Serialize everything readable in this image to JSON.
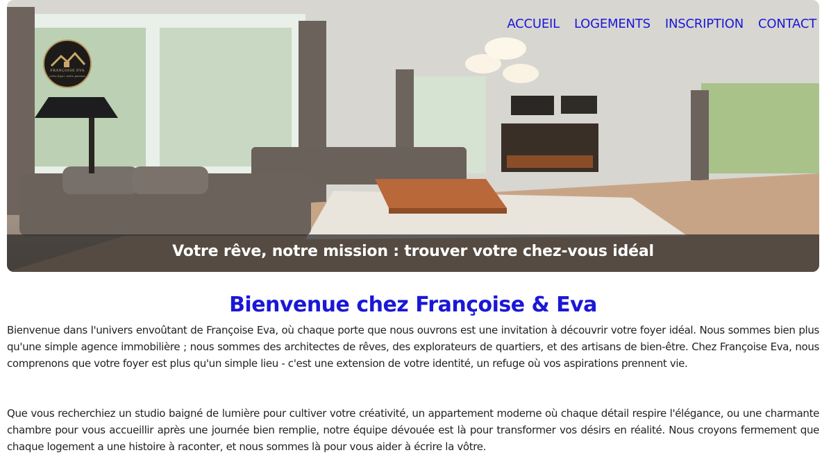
{
  "nav": {
    "items": [
      "ACCUEIL",
      "LOGEMENTS",
      "INSCRIPTION",
      "CONTACT"
    ]
  },
  "logo": {
    "name": "FRANÇOISE EVA",
    "tagline": "votre foyer, notre passion"
  },
  "hero": {
    "caption": "Votre rêve, notre mission : trouver votre chez-vous idéal"
  },
  "main": {
    "title": "Bienvenue chez Françoise & Eva",
    "paragraphs": [
      "Bienvenue dans l'univers envoûtant de Françoise Eva, où chaque porte que nous ouvrons est une invitation à découvrir votre foyer idéal. Nous sommes bien plus qu'une simple agence immobilière ; nous sommes des architectes de rêves, des explorateurs de quartiers, et des artisans de bien-être. Chez Françoise Eva, nous comprenons que votre foyer est plus qu'un simple lieu - c'est une extension de votre identité, un refuge où vos aspirations prennent vie.",
      "Que vous recherchiez un studio baigné de lumière pour cultiver votre créativité, un appartement moderne où chaque détail respire l'élégance, ou une charmante chambre pour vous accueillir après une journée bien remplie, notre équipe dévouée est là pour transformer vos désirs en réalité. Nous croyons fermement que chaque logement a une histoire à raconter, et nous sommes là pour vous aider à écrire la vôtre."
    ]
  },
  "colors": {
    "accent": "#1b17d6",
    "text": "#222222",
    "caption_band": "#282828"
  }
}
